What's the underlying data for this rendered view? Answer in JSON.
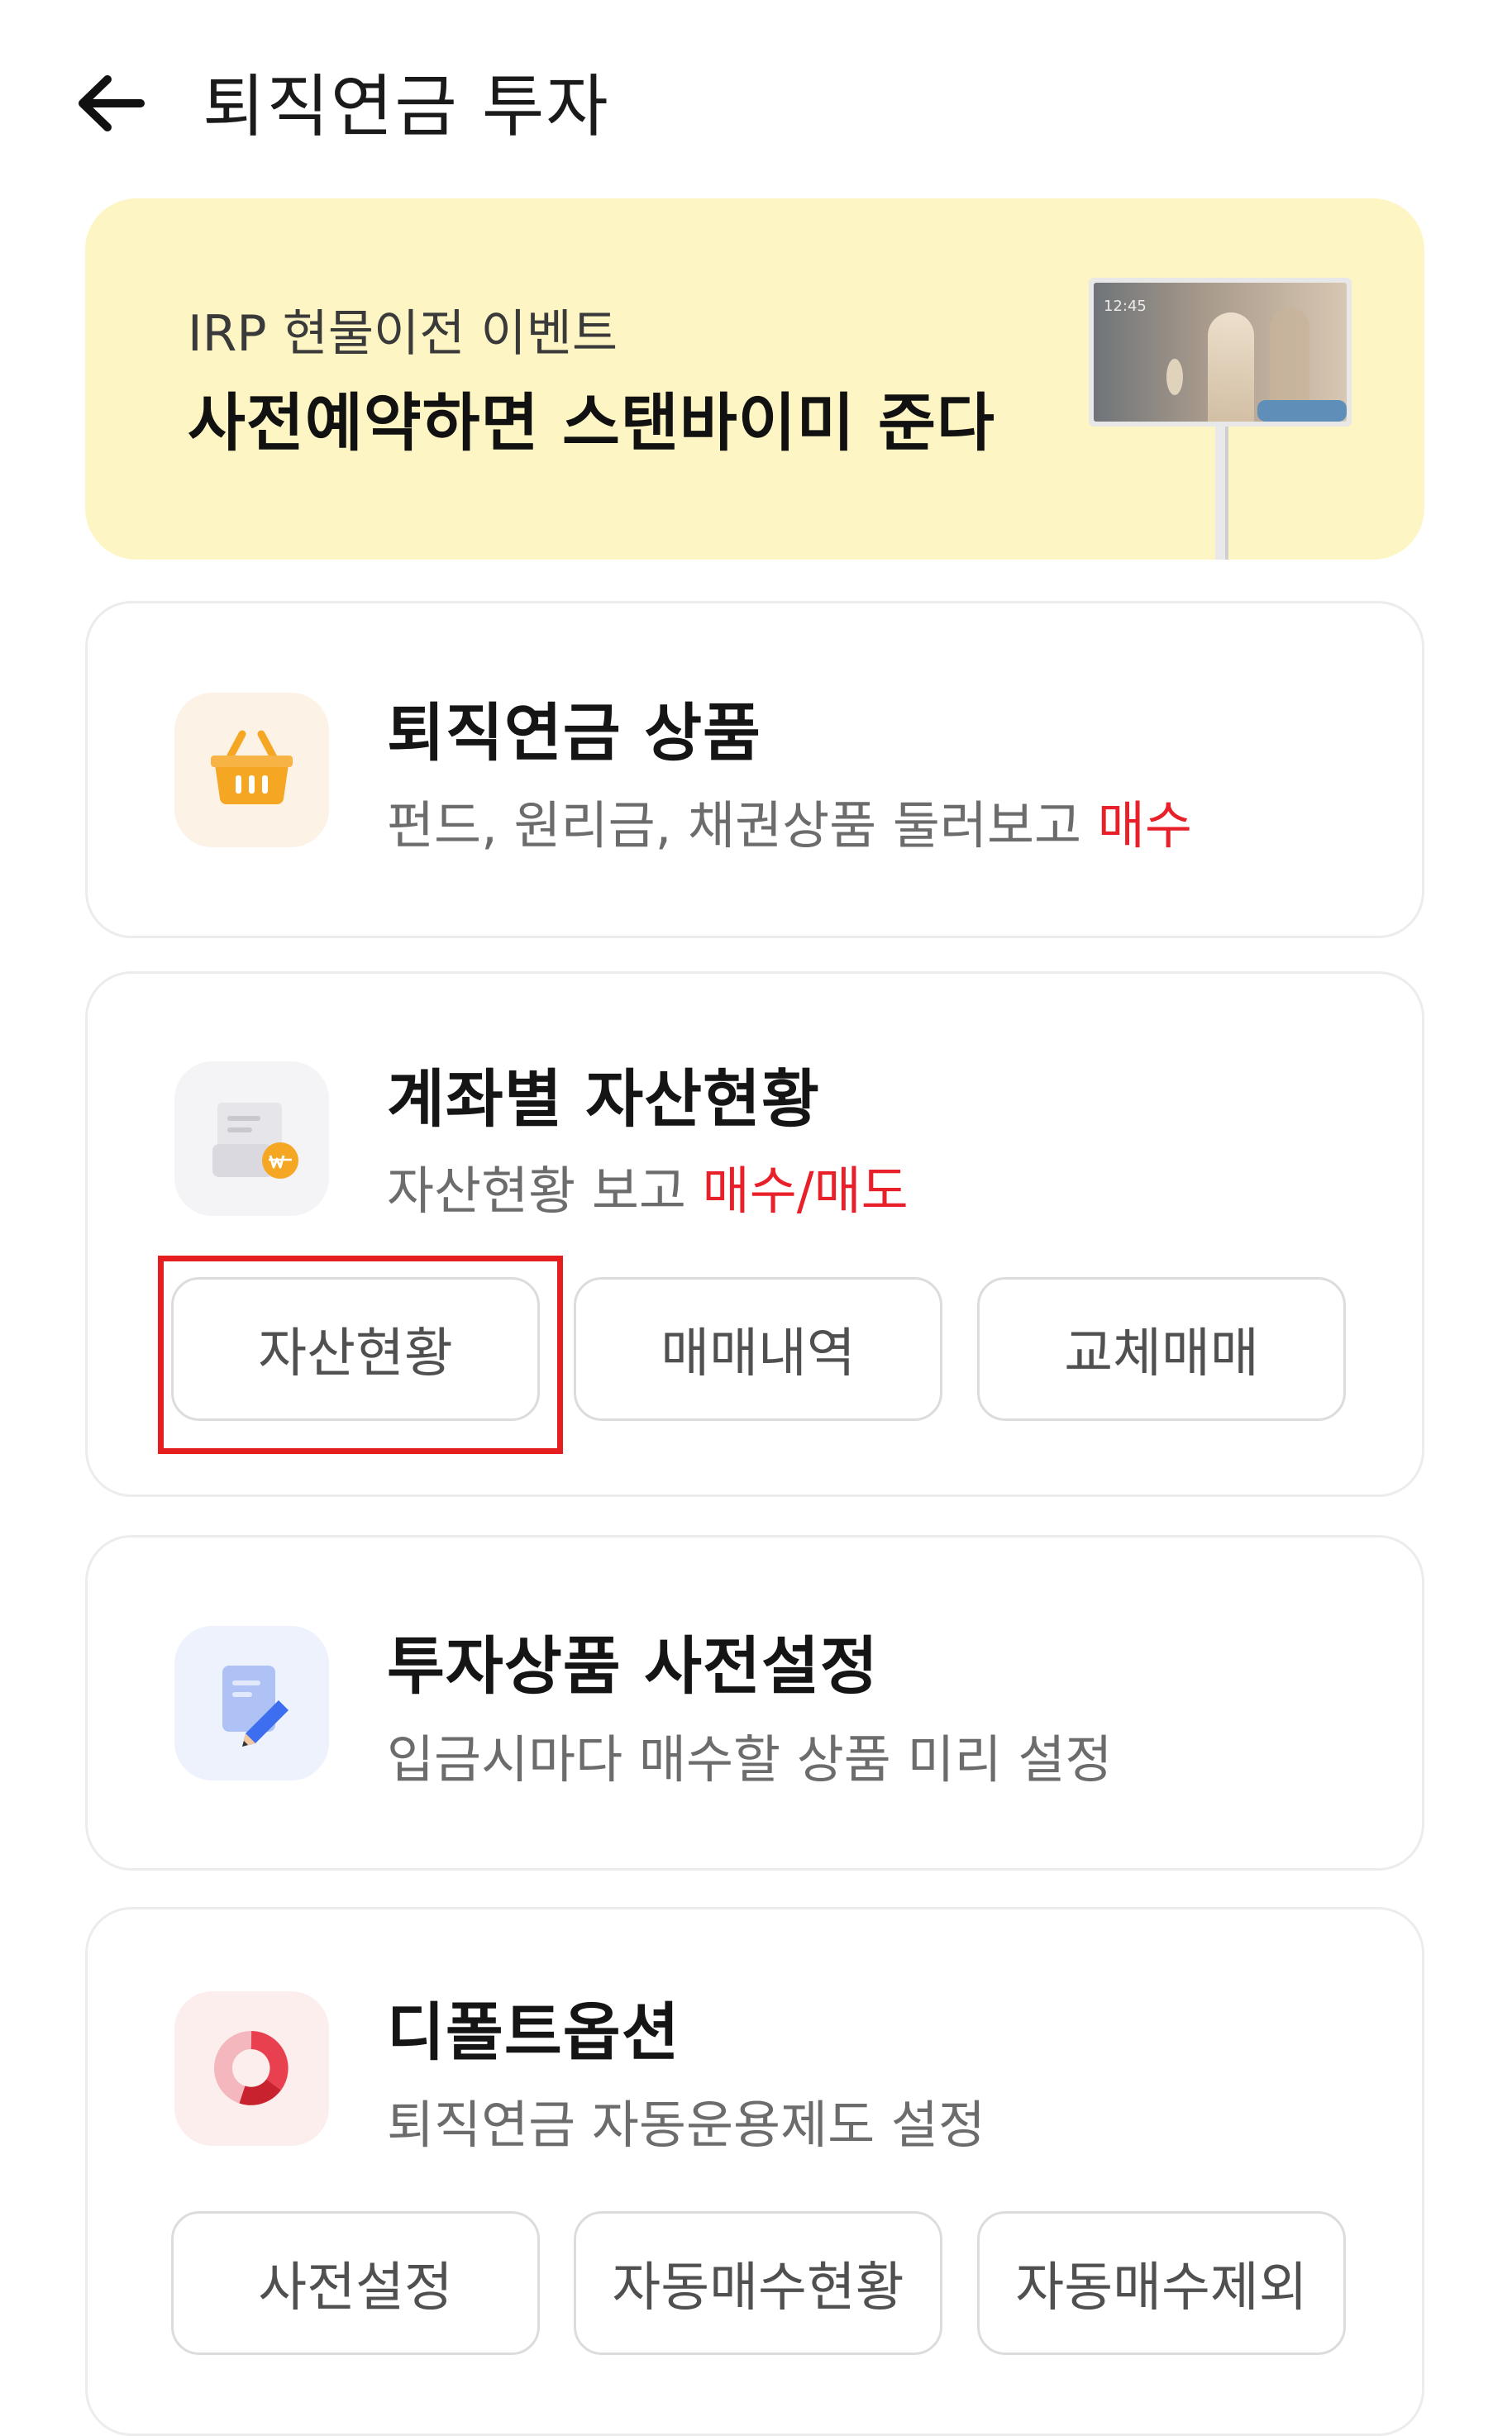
{
  "header": {
    "title": "퇴직연금 투자"
  },
  "banner": {
    "subtitle": "IRP 현물이전 이벤트",
    "title": "사전예약하면 스탠바이미 준다",
    "image_time": "12:45"
  },
  "cards": [
    {
      "title": "퇴직연금 상품",
      "desc": "펀드, 원리금, 채권상품 둘러보고 ",
      "desc_highlight": "매수",
      "icon": "basket-icon"
    },
    {
      "title": "계좌별 자산현황",
      "desc": "자산현황 보고 ",
      "desc_highlight": "매수/매도",
      "icon": "account-won-icon",
      "buttons": [
        "자산현황",
        "매매내역",
        "교체매매"
      ]
    },
    {
      "title": "투자상품 사전설정",
      "desc": "입금시마다 매수할 상품 미리 설정",
      "icon": "document-edit-icon"
    },
    {
      "title": "디폴트옵션",
      "desc": "퇴직연금 자동운용제도 설정",
      "icon": "donut-chart-icon",
      "buttons": [
        "사전설정",
        "자동매수현황",
        "자동매수제외"
      ]
    }
  ],
  "colors": {
    "accent_red": "#e8202a",
    "banner_bg": "#fdf6c4",
    "icon_orange": "#f5a623"
  }
}
